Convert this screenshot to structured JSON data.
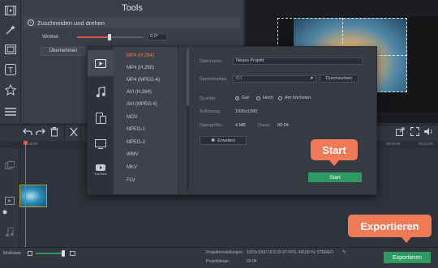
{
  "tools": {
    "title": "Tools",
    "subtitle": "Zuschneiden und drehen",
    "angle_label": "Winkel:",
    "angle_value": "0,0°",
    "apply_label": "Übernehmen"
  },
  "timeline": {
    "time_start": "00:00:00",
    "time_right": "00:00:55",
    "time_right2": "00:01:00"
  },
  "dialog": {
    "formats": [
      "MP4 (H.264)",
      "MP4 (H.265)",
      "MP4 (MPEG-4)",
      "AVI (H.264)",
      "AVI (MPEG-4)",
      "MOV",
      "MPEG-1",
      "MPEG-2",
      "WMV",
      "MKV",
      "FLV"
    ],
    "selected_format_color": "#f07a55",
    "filename_label": "Dateiname:",
    "filename_value": "Neues Projekt",
    "path_label": "Speicherpfad:",
    "path_value": "C:\\",
    "browse_label": "Durchsuchen",
    "quality_label": "Qualität:",
    "quality_options": [
      "Gut",
      "Hoch",
      "Am höchsten"
    ],
    "quality_selected": "Gut",
    "resolution_label": "Auflösung:",
    "resolution_value": "1920x1080",
    "filesize_label": "Dateigröße:",
    "filesize_value": "4 MB",
    "duration_label": "Dauer:",
    "duration_value": "00:04",
    "advanced_label": "Erweitert",
    "start_button": "Start",
    "youtube_text": "YouTube"
  },
  "callouts": {
    "start": "Start",
    "export": "Exportieren"
  },
  "bottom": {
    "scale_label": "Maßstab:",
    "settings_label": "Projekteinstellungen:",
    "settings_value": "1920x1080 16:9 29.97 FPS, 44100 Hz STEREO",
    "duration_label": "Projektlänge:",
    "duration_value": "00:04",
    "export_button": "Exportieren"
  },
  "colors": {
    "accent_green": "#2e9a63",
    "callout_orange": "#f07a55",
    "playhead": "#e0554b"
  }
}
